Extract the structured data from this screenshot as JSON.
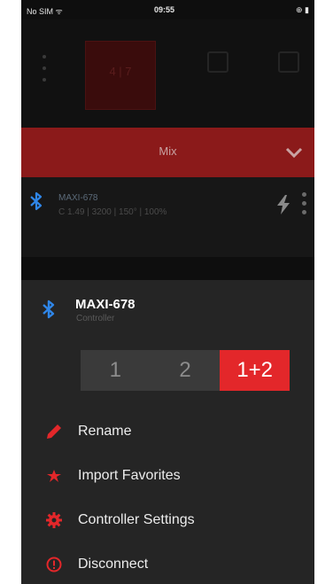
{
  "status_bar": {
    "carrier": "No SIM ᯤ",
    "time": "09:55",
    "battery": "⊕ ▮"
  },
  "top_tile": {
    "label": "4 | 7"
  },
  "mix_bar": {
    "label": "Mix"
  },
  "device_row": {
    "name": "MAXI-678",
    "info": "C 1.49 | 3200 | 150° | 100%"
  },
  "sheet": {
    "title": "MAXI-678",
    "subtitle": "Controller",
    "segments": [
      "1",
      "2",
      "1+2"
    ],
    "menu": [
      {
        "label": "Rename",
        "icon": "pencil-icon"
      },
      {
        "label": "Import Favorites",
        "icon": "star-icon"
      },
      {
        "label": "Controller Settings",
        "icon": "gear-icon"
      },
      {
        "label": "Disconnect",
        "icon": "power-icon"
      }
    ]
  },
  "colors": {
    "accent": "#e3272a",
    "bar": "#8b1a1a",
    "bluetooth": "#2f86e8"
  }
}
